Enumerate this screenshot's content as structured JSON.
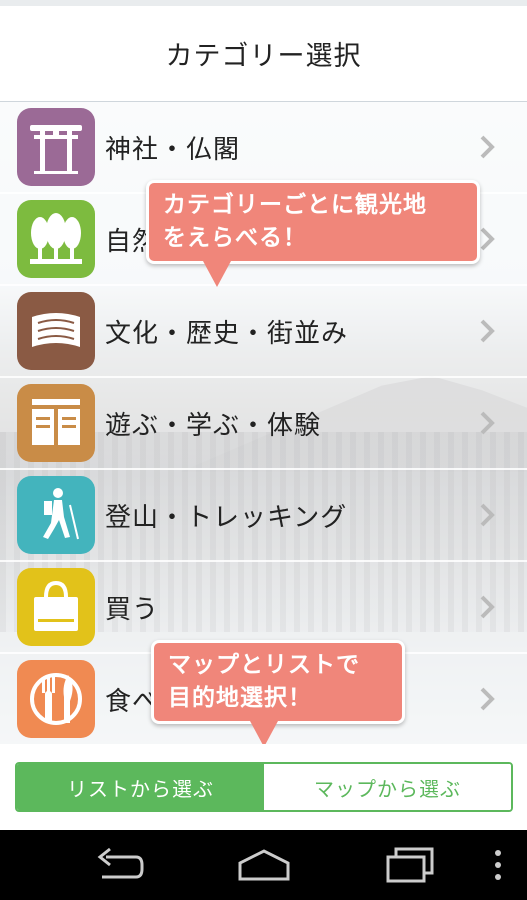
{
  "header": {
    "title": "カテゴリー選択"
  },
  "categories": [
    {
      "label": "神社・仏閣",
      "icon": "torii-icon",
      "color": "#9b6a96"
    },
    {
      "label": "自然",
      "icon": "trees-icon",
      "color": "#7dbb3f"
    },
    {
      "label": "文化・歴史・街並み",
      "icon": "scroll-icon",
      "color": "#8a5a44"
    },
    {
      "label": "遊ぶ・学ぶ・体験",
      "icon": "book-icon",
      "color": "#c98c47"
    },
    {
      "label": "登山・トレッキング",
      "icon": "hiker-icon",
      "color": "#43b4bd"
    },
    {
      "label": "買う",
      "icon": "shopping-bag-icon",
      "color": "#e2c21a"
    },
    {
      "label": "食べる",
      "icon": "fork-knife-icon",
      "color": "#f08a52"
    }
  ],
  "tooltips": {
    "category": {
      "line1": "カテゴリーごとに観光地",
      "line2": "をえらべる！"
    },
    "map": {
      "line1": "マップとリストで",
      "line2": "目的地選択！"
    }
  },
  "segment": {
    "list_label": "リストから選ぶ",
    "map_label": "マップから選ぶ"
  },
  "colors": {
    "accent": "#5cb85c",
    "tooltip": "#f0867a"
  }
}
